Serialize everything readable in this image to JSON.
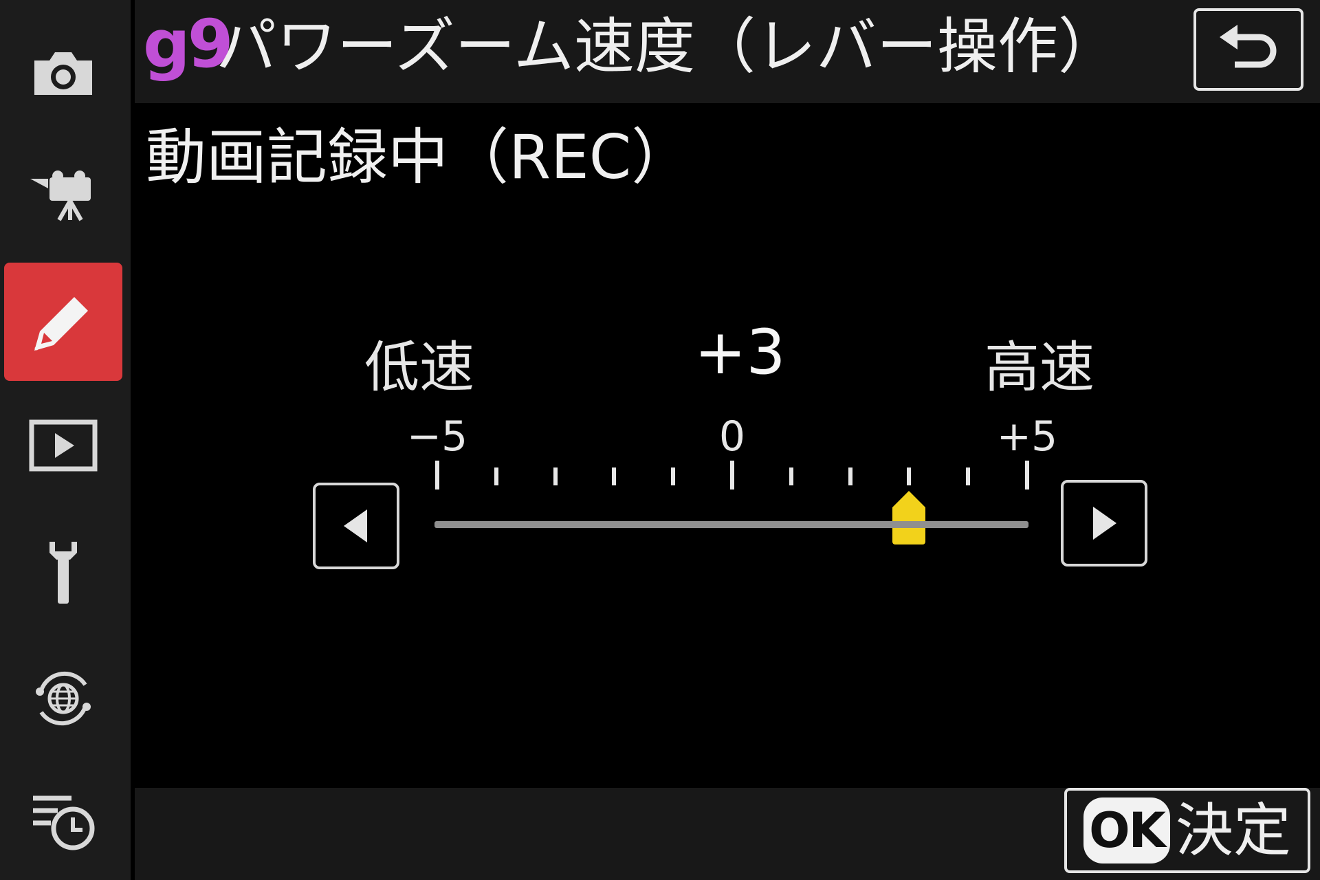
{
  "header": {
    "code": "g9",
    "title": "パワーズーム速度（レバー操作）"
  },
  "subtitle": "動画記録中（REC）",
  "slider": {
    "low_label": "低速",
    "high_label": "高速",
    "current_display": "+3",
    "current_value": 3,
    "min": -5,
    "max": 5,
    "tick_labels": [
      {
        "value": -5,
        "text": "−5"
      },
      {
        "value": 0,
        "text": "0"
      },
      {
        "value": 5,
        "text": "+5"
      }
    ],
    "handle_color": "#f2d21b"
  },
  "footer": {
    "ok_badge": "OK",
    "ok_label": "決定"
  },
  "sidebar": {
    "items": [
      {
        "icon": "camera-icon"
      },
      {
        "icon": "movie-camera-icon"
      },
      {
        "icon": "pencil-icon",
        "active": true
      },
      {
        "icon": "playback-icon"
      },
      {
        "icon": "wrench-icon"
      },
      {
        "icon": "network-globe-icon"
      },
      {
        "icon": "recent-settings-icon"
      }
    ],
    "active_color": "#d9383b"
  },
  "accent_colors": {
    "code": "#c04fd6",
    "active": "#d9383b",
    "handle": "#f2d21b"
  }
}
